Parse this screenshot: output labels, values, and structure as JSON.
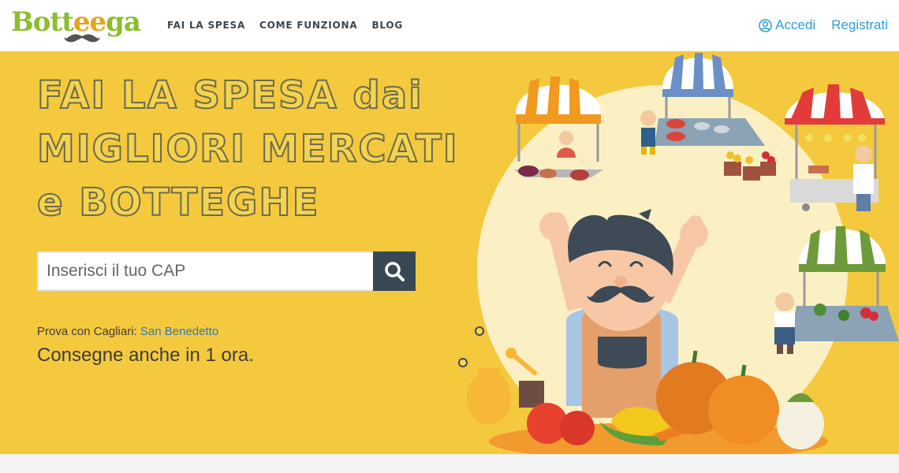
{
  "header": {
    "logo": {
      "part1": "Bott",
      "part2": "ee",
      "part3": "ga"
    },
    "nav": [
      "FAI LA SPESA",
      "COME FUNZIONA",
      "BLOG"
    ],
    "login_label": "Accedi",
    "register_label": "Registrati"
  },
  "hero": {
    "headline_lines": [
      "FAI LA SPESA dai",
      "MIGLIORI MERCATI",
      "e BOTTEGHE"
    ],
    "search": {
      "placeholder": "Inserisci il tuo CAP",
      "value": ""
    },
    "try_prefix": "Prova con Cagliari:",
    "try_link": "San Benedetto",
    "delivery": "Consegne anche in 1 ora."
  },
  "colors": {
    "hero_bg": "#f5c93e",
    "search_button": "#394854",
    "link": "#2f9bd6",
    "logo_green": "#8cbd2c",
    "logo_orange": "#e9a21d"
  },
  "icons": [
    "user-circle-icon",
    "search-icon",
    "mustache-icon"
  ]
}
